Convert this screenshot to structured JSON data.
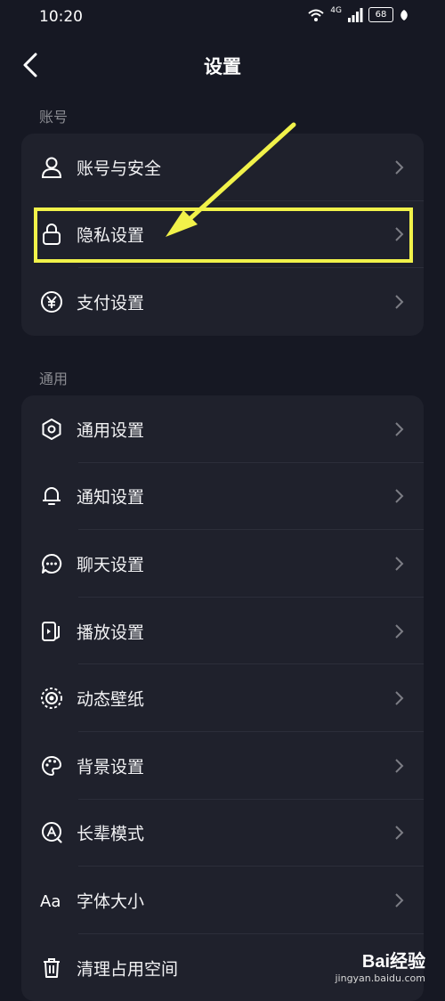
{
  "status_bar": {
    "time": "10:20",
    "network": "4G",
    "battery": "68"
  },
  "header": {
    "title": "设置"
  },
  "sections": [
    {
      "label": "账号",
      "items": [
        {
          "label": "账号与安全",
          "icon": "user-icon"
        },
        {
          "label": "隐私设置",
          "icon": "lock-icon"
        },
        {
          "label": "支付设置",
          "icon": "yen-icon"
        }
      ]
    },
    {
      "label": "通用",
      "items": [
        {
          "label": "通用设置",
          "icon": "gear-icon"
        },
        {
          "label": "通知设置",
          "icon": "bell-icon"
        },
        {
          "label": "聊天设置",
          "icon": "chat-icon"
        },
        {
          "label": "播放设置",
          "icon": "play-settings-icon"
        },
        {
          "label": "动态壁纸",
          "icon": "wallpaper-icon"
        },
        {
          "label": "背景设置",
          "icon": "palette-icon"
        },
        {
          "label": "长辈模式",
          "icon": "elder-mode-icon"
        },
        {
          "label": "字体大小",
          "icon": "font-size-icon"
        },
        {
          "label": "清理占用空间",
          "icon": "trash-icon"
        }
      ]
    }
  ],
  "annotation": {
    "color": "#f1f24a"
  },
  "watermark": {
    "brand": "Bai经验",
    "site": "jingyan.baidu.com"
  }
}
